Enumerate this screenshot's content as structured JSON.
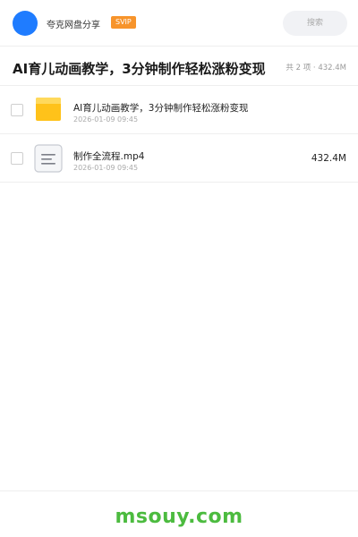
{
  "header": {
    "app_name": "夸克网盘分享",
    "badge": "SVIP",
    "search_placeholder": "搜索",
    "avatar_color": "#1f7cff",
    "badge_color": "#f7942b"
  },
  "title_row": {
    "title": "AI育儿动画教学，3分钟制作轻松涨粉变现",
    "summary": "共 2 项 · 432.4M"
  },
  "files": [
    {
      "name": "AI育儿动画教学，3分钟制作轻松涨粉变现",
      "date": "2026-01-09 09:45",
      "size": "",
      "icon": "folder-icon"
    },
    {
      "name": "制作全流程.mp4",
      "date": "2026-01-09 09:45",
      "size": "432.4M",
      "icon": "document-icon"
    }
  ],
  "footer": {
    "brand": "msouy.com",
    "brand_color": "#4cbb3f"
  }
}
